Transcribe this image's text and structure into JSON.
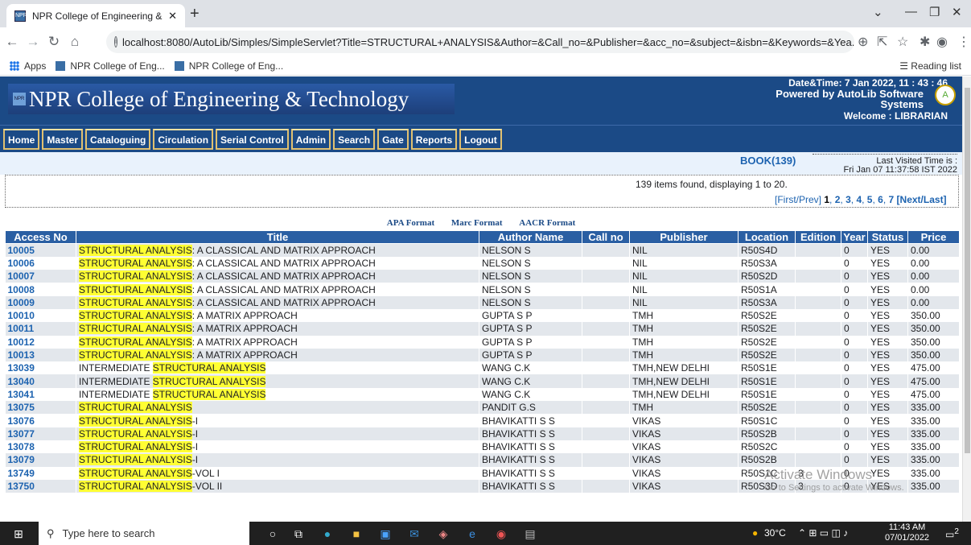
{
  "browser": {
    "tab_title": "NPR College of Engineering & Te",
    "url": "localhost:8080/AutoLib/Simples/SimpleServlet?Title=STRUCTURAL+ANALYSIS&Author=&Call_no=&Publisher=&acc_no=&subject=&isbn=&Keywords=&Yea...",
    "bookmarks": [
      "Apps",
      "NPR College of Eng...",
      "NPR College of Eng..."
    ],
    "reading_list": "Reading list"
  },
  "header": {
    "college": "NPR College of Engineering & Technology",
    "datetime": "Date&Time:  7 Jan 2022, 11 : 43 : 46",
    "powered1": "Powered by AutoLib Software",
    "powered2": "Systems",
    "welcome": "Welcome   :  LIBRARIAN"
  },
  "menu": [
    "Home",
    "Master",
    "Cataloguing",
    "Circulation",
    "Serial Control",
    "Admin",
    "Search",
    "Gate",
    "Reports",
    "Logout"
  ],
  "info": {
    "book": "BOOK(139)",
    "last_visited_label": "Last Visited Time is :",
    "last_visited": "Fri Jan 07 11:37:58 IST 2022",
    "found": "139 items found, displaying 1 to 20.",
    "pager_prefix": "[First/Prev]",
    "pager_current": "1",
    "pager_pages": [
      "2",
      "3",
      "4",
      "5",
      "6",
      "7"
    ],
    "pager_suffix": "[Next/Last]"
  },
  "formats": [
    "APA Format",
    "Marc Format",
    "AACR Format"
  ],
  "table": {
    "columns": [
      "Access No",
      "Title",
      "Author Name",
      "Call no",
      "Publisher",
      "Location",
      "Edition",
      "Year",
      "Status",
      "Price"
    ],
    "rows": [
      {
        "acc": "10005",
        "pre": "",
        "hl": "STRUCTURAL ANALYSIS",
        "post": ": A CLASSICAL AND MATRIX APPROACH",
        "author": "NELSON S",
        "call": "",
        "pub": "NIL",
        "loc": "R50S4D",
        "ed": "",
        "year": "0",
        "status": "YES",
        "price": "0.00"
      },
      {
        "acc": "10006",
        "pre": "",
        "hl": "STRUCTURAL ANALYSIS",
        "post": ": A CLASSICAL AND MATRIX APPROACH",
        "author": "NELSON S",
        "call": "",
        "pub": "NIL",
        "loc": "R50S3A",
        "ed": "",
        "year": "0",
        "status": "YES",
        "price": "0.00"
      },
      {
        "acc": "10007",
        "pre": "",
        "hl": "STRUCTURAL ANALYSIS",
        "post": ": A CLASSICAL AND MATRIX APPROACH",
        "author": "NELSON S",
        "call": "",
        "pub": "NIL",
        "loc": "R50S2D",
        "ed": "",
        "year": "0",
        "status": "YES",
        "price": "0.00"
      },
      {
        "acc": "10008",
        "pre": "",
        "hl": "STRUCTURAL ANALYSIS",
        "post": ": A CLASSICAL AND MATRIX APPROACH",
        "author": "NELSON S",
        "call": "",
        "pub": "NIL",
        "loc": "R50S1A",
        "ed": "",
        "year": "0",
        "status": "YES",
        "price": "0.00"
      },
      {
        "acc": "10009",
        "pre": "",
        "hl": "STRUCTURAL ANALYSIS",
        "post": ": A CLASSICAL AND MATRIX APPROACH",
        "author": "NELSON S",
        "call": "",
        "pub": "NIL",
        "loc": "R50S3A",
        "ed": "",
        "year": "0",
        "status": "YES",
        "price": "0.00"
      },
      {
        "acc": "10010",
        "pre": "",
        "hl": "STRUCTURAL ANALYSIS",
        "post": ": A MATRIX APPROACH",
        "author": "GUPTA S P",
        "call": "",
        "pub": "TMH",
        "loc": "R50S2E",
        "ed": "",
        "year": "0",
        "status": "YES",
        "price": "350.00"
      },
      {
        "acc": "10011",
        "pre": "",
        "hl": "STRUCTURAL ANALYSIS",
        "post": ": A MATRIX APPROACH",
        "author": "GUPTA S P",
        "call": "",
        "pub": "TMH",
        "loc": "R50S2E",
        "ed": "",
        "year": "0",
        "status": "YES",
        "price": "350.00"
      },
      {
        "acc": "10012",
        "pre": "",
        "hl": "STRUCTURAL ANALYSIS",
        "post": ": A MATRIX APPROACH",
        "author": "GUPTA S P",
        "call": "",
        "pub": "TMH",
        "loc": "R50S2E",
        "ed": "",
        "year": "0",
        "status": "YES",
        "price": "350.00"
      },
      {
        "acc": "10013",
        "pre": "",
        "hl": "STRUCTURAL ANALYSIS",
        "post": ": A MATRIX APPROACH",
        "author": "GUPTA S P",
        "call": "",
        "pub": "TMH",
        "loc": "R50S2E",
        "ed": "",
        "year": "0",
        "status": "YES",
        "price": "350.00"
      },
      {
        "acc": "13039",
        "pre": "INTERMEDIATE ",
        "hl": "STRUCTURAL ANALYSIS",
        "post": "",
        "author": "WANG C.K",
        "call": "",
        "pub": "TMH,NEW DELHI",
        "loc": "R50S1E",
        "ed": "",
        "year": "0",
        "status": "YES",
        "price": "475.00"
      },
      {
        "acc": "13040",
        "pre": "INTERMEDIATE ",
        "hl": "STRUCTURAL ANALYSIS",
        "post": "",
        "author": "WANG C.K",
        "call": "",
        "pub": "TMH,NEW DELHI",
        "loc": "R50S1E",
        "ed": "",
        "year": "0",
        "status": "YES",
        "price": "475.00"
      },
      {
        "acc": "13041",
        "pre": "INTERMEDIATE ",
        "hl": "STRUCTURAL ANALYSIS",
        "post": "",
        "author": "WANG C.K",
        "call": "",
        "pub": "TMH,NEW DELHI",
        "loc": "R50S1E",
        "ed": "",
        "year": "0",
        "status": "YES",
        "price": "475.00"
      },
      {
        "acc": "13075",
        "pre": "",
        "hl": "STRUCTURAL ANALYSIS",
        "post": "",
        "author": "PANDIT G.S",
        "call": "",
        "pub": "TMH",
        "loc": "R50S2E",
        "ed": "",
        "year": "0",
        "status": "YES",
        "price": "335.00"
      },
      {
        "acc": "13076",
        "pre": "",
        "hl": "STRUCTURAL ANALYSIS",
        "post": "-I",
        "author": "BHAVIKATTI S S",
        "call": "",
        "pub": "VIKAS",
        "loc": "R50S1C",
        "ed": "",
        "year": "0",
        "status": "YES",
        "price": "335.00"
      },
      {
        "acc": "13077",
        "pre": "",
        "hl": "STRUCTURAL ANALYSIS",
        "post": "-I",
        "author": "BHAVIKATTI S S",
        "call": "",
        "pub": "VIKAS",
        "loc": "R50S2B",
        "ed": "",
        "year": "0",
        "status": "YES",
        "price": "335.00"
      },
      {
        "acc": "13078",
        "pre": "",
        "hl": "STRUCTURAL ANALYSIS",
        "post": "-I",
        "author": "BHAVIKATTI S S",
        "call": "",
        "pub": "VIKAS",
        "loc": "R50S2C",
        "ed": "",
        "year": "0",
        "status": "YES",
        "price": "335.00"
      },
      {
        "acc": "13079",
        "pre": "",
        "hl": "STRUCTURAL ANALYSIS",
        "post": "-I",
        "author": "BHAVIKATTI S S",
        "call": "",
        "pub": "VIKAS",
        "loc": "R50S2B",
        "ed": "",
        "year": "0",
        "status": "YES",
        "price": "335.00"
      },
      {
        "acc": "13749",
        "pre": "",
        "hl": "STRUCTURAL ANALYSIS",
        "post": "-VOL I",
        "author": "BHAVIKATTI S S",
        "call": "",
        "pub": "VIKAS",
        "loc": "R50S1C",
        "ed": "3",
        "year": "0",
        "status": "YES",
        "price": "335.00"
      },
      {
        "acc": "13750",
        "pre": "",
        "hl": "STRUCTURAL ANALYSIS",
        "post": "-VOL II",
        "author": "BHAVIKATTI S S",
        "call": "",
        "pub": "VIKAS",
        "loc": "R50S3D",
        "ed": "3",
        "year": "0",
        "status": "YES",
        "price": "335.00"
      }
    ]
  },
  "watermark": {
    "line1": "Activate Windows",
    "line2": "Go to Settings to activate Windows."
  },
  "taskbar": {
    "search": "Type here to search",
    "temp": "30°C",
    "time": "11:43 AM",
    "date": "07/01/2022",
    "notif": "2"
  },
  "colors": {
    "header_bg": "#1b4a86",
    "highlight": "#ffff33",
    "link": "#1d63b0"
  }
}
